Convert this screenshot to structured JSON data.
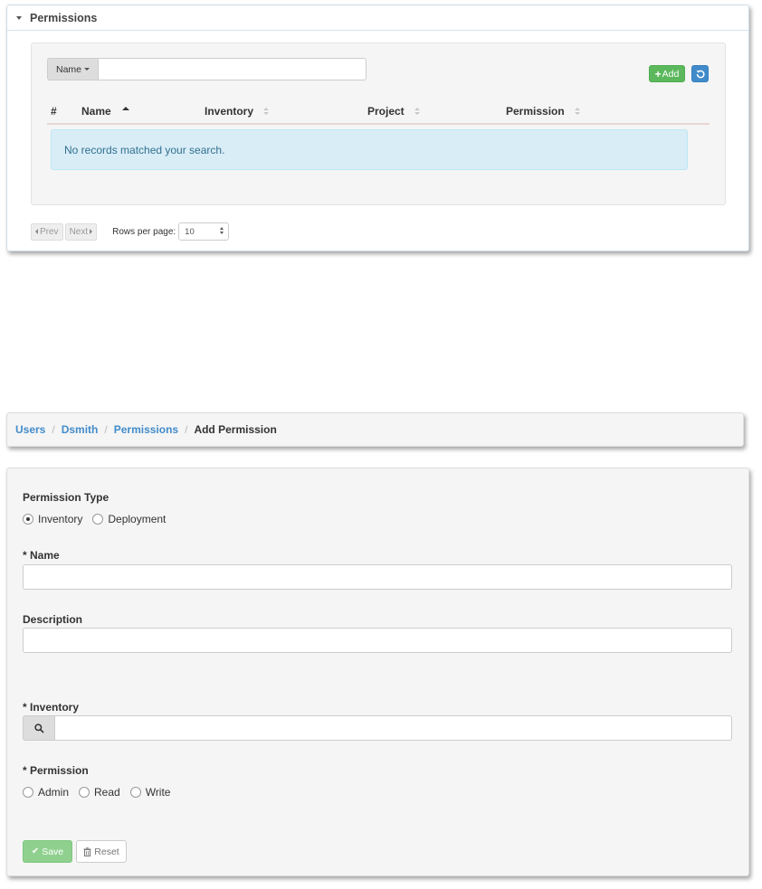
{
  "permissions_panel": {
    "title": "Permissions",
    "search": {
      "dropdown_label": "Name",
      "input_value": "",
      "placeholder": ""
    },
    "add_label": "Add",
    "columns": [
      "#",
      "Name",
      "Inventory",
      "Project",
      "Permission"
    ],
    "empty_message": "No records matched your search.",
    "pager": {
      "prev_label": "Prev",
      "next_label": "Next",
      "rows_label": "Rows per page:",
      "rows_value": "10"
    }
  },
  "breadcrumb": {
    "items": [
      "Users",
      "Dsmith",
      "Permissions"
    ],
    "separator": "/",
    "current": "Add Permission"
  },
  "form": {
    "permission_type": {
      "label": "Permission Type",
      "options": [
        "Inventory",
        "Deployment"
      ],
      "selected": "Inventory"
    },
    "name": {
      "label": "* Name",
      "value": ""
    },
    "description": {
      "label": "Description",
      "value": ""
    },
    "inventory": {
      "label": "* Inventory",
      "value": ""
    },
    "permission": {
      "label": "* Permission",
      "options": [
        "Admin",
        "Read",
        "Write"
      ],
      "selected": ""
    },
    "save_label": "Save",
    "reset_label": "Reset"
  },
  "colors": {
    "link": "#428bca",
    "add_button": "#5cb85c",
    "refresh_button": "#428bca",
    "save_button_disabled": "#8fd08f",
    "info_background": "#d9edf7",
    "info_text": "#31708f"
  },
  "icons": {
    "collapse": "caret-down-icon",
    "add": "plus-icon",
    "refresh": "refresh-icon",
    "search": "search-icon",
    "save": "check-icon",
    "reset": "trash-icon"
  }
}
